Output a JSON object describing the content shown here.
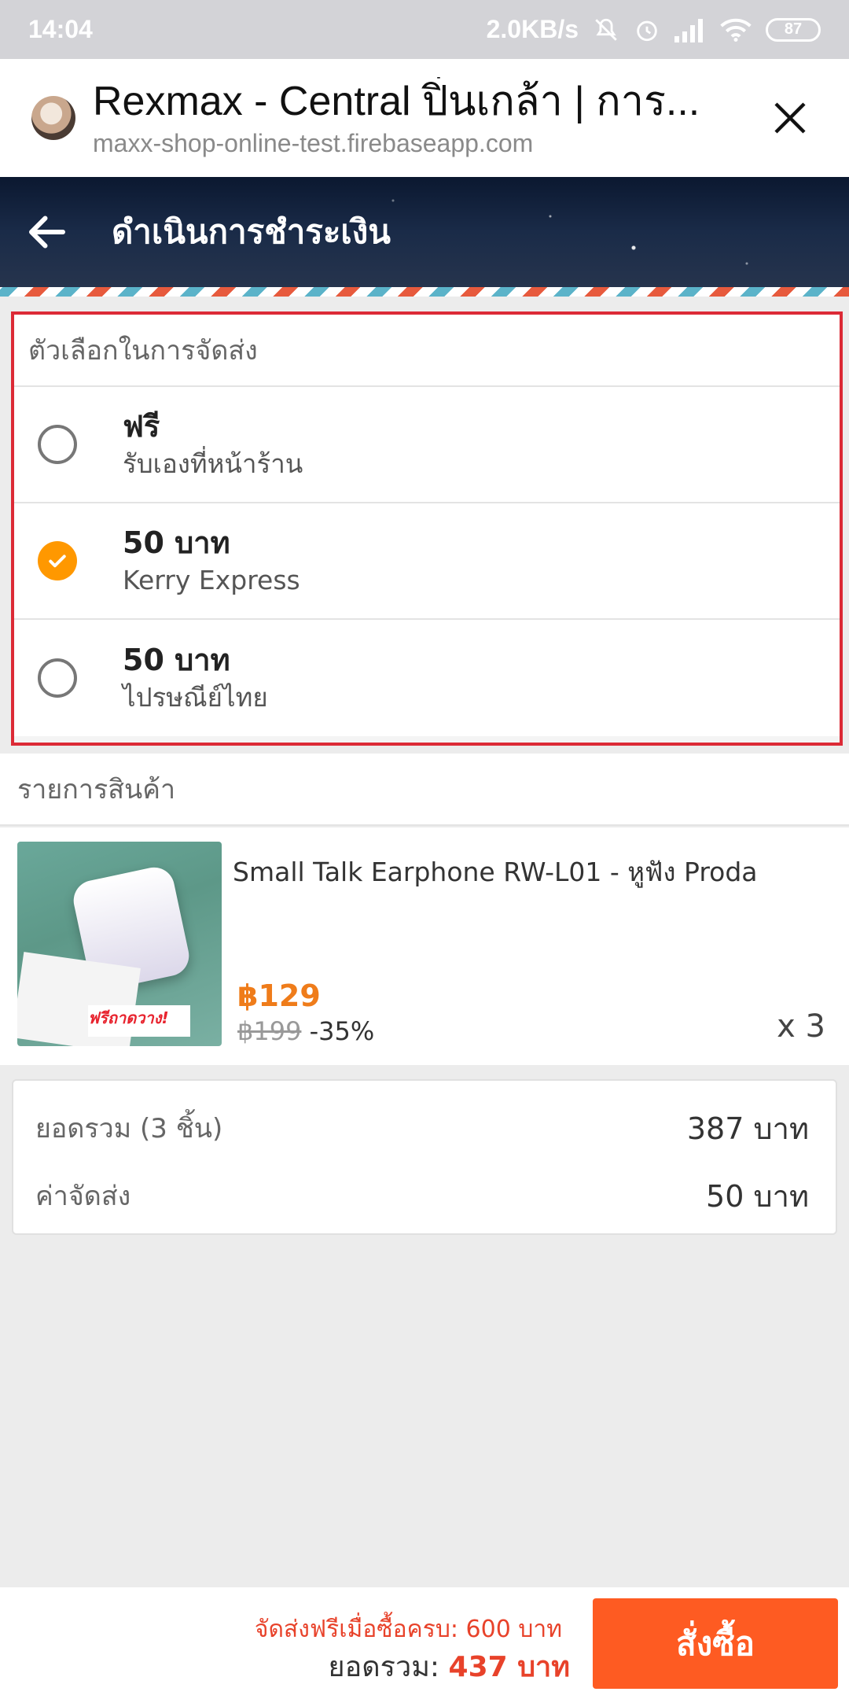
{
  "status_bar": {
    "time": "14:04",
    "network_speed": "2.0KB/s",
    "battery": "87",
    "icons": [
      "bell-muted-icon",
      "alarm-icon",
      "signal-icon",
      "wifi-icon",
      "battery-icon"
    ]
  },
  "browser": {
    "title": "Rexmax - Central ปิ่นเกล้า | การ...",
    "url": "maxx-shop-online-test.firebaseapp.com"
  },
  "app_bar": {
    "title": "ดำเนินการชำระเงิน"
  },
  "shipping": {
    "header": "ตัวเลือกในการจัดส่ง",
    "options": [
      {
        "price": "ฟรี",
        "name": "รับเองที่หน้าร้าน",
        "selected": false
      },
      {
        "price": "50 บาท",
        "name": "Kerry Express",
        "selected": true
      },
      {
        "price": "50 บาท",
        "name": "ไปรษณีย์ไทย",
        "selected": false
      }
    ]
  },
  "products": {
    "header": "รายการสินค้า",
    "items": [
      {
        "name": "Small Talk Earphone RW-L01 - หูฟัง Proda",
        "price": "฿129",
        "old_price": "฿199",
        "discount": "-35%",
        "quantity": "x 3",
        "image_text": "ฟรีถาดวาง!"
      }
    ]
  },
  "summary": {
    "subtotal_label": "ยอดรวม (3 ชิ้น)",
    "subtotal_value": "387 บาท",
    "shipping_label": "ค่าจัดส่ง",
    "shipping_value": "50 บาท"
  },
  "footer": {
    "free_shipping_note": "จัดส่งฟรีเมื่อซื้อครบ: 600 บาท",
    "total_label": "ยอดรวม:",
    "total_value": "437 บาท",
    "order_button": "สั่งซื้อ"
  },
  "colors": {
    "accent_orange": "#fe5b22",
    "selected_radio": "#ff9800",
    "price_orange": "#ef7c1a",
    "highlight_border": "#dc2a36"
  }
}
